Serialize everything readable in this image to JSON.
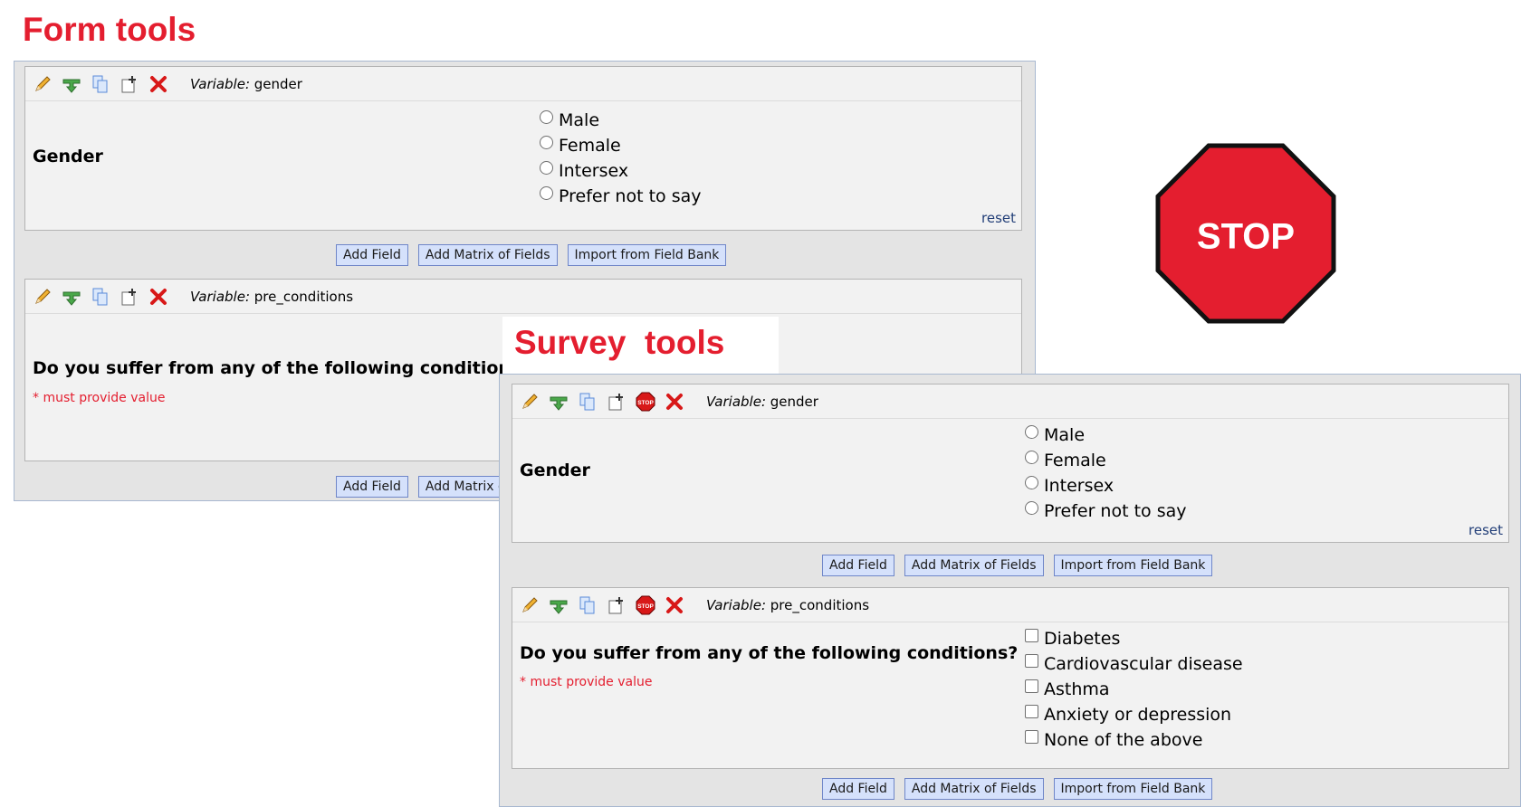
{
  "form_section": {
    "heading": "Form tools",
    "fields": [
      {
        "variable_label": "Variable:",
        "variable_name": "gender",
        "question": "Gender",
        "options": [
          "Male",
          "Female",
          "Intersex",
          "Prefer not to say"
        ],
        "reset_label": "reset"
      },
      {
        "variable_label": "Variable:",
        "variable_name": "pre_conditions",
        "question": "Do you suffer from any of the following conditions?",
        "required_note": "* must provide value"
      }
    ],
    "buttons": [
      "Add Field",
      "Add Matrix of Fields",
      "Import from Field Bank"
    ],
    "buttons_bottom_visible": [
      "Add Field",
      "Add Matrix o"
    ]
  },
  "survey_section": {
    "heading": "Survey  tools",
    "fields": [
      {
        "variable_label": "Variable:",
        "variable_name": "gender",
        "question": "Gender",
        "options": [
          "Male",
          "Female",
          "Intersex",
          "Prefer not to say"
        ],
        "reset_label": "reset"
      },
      {
        "variable_label": "Variable:",
        "variable_name": "pre_conditions",
        "question": "Do you suffer from any of the following conditions?",
        "required_note": "* must provide value",
        "options": [
          "Diabetes",
          "Cardiovascular disease",
          "Asthma",
          "Anxiety or depression",
          "None of the above"
        ]
      }
    ],
    "buttons": [
      "Add Field",
      "Add Matrix of Fields",
      "Import from Field Bank"
    ]
  },
  "stop_sign": {
    "text": "STOP",
    "color": "#e41e2f"
  },
  "icons": {
    "form_toolbar": [
      "pencil-icon",
      "branching-arrow-icon",
      "copy-icon",
      "move-icon",
      "delete-icon"
    ],
    "survey_toolbar": [
      "pencil-icon",
      "branching-arrow-icon",
      "copy-icon",
      "move-icon",
      "stop-action-icon",
      "delete-icon"
    ]
  },
  "colors": {
    "accent_red": "#e41e2f",
    "button_bg": "#d5e1fb",
    "panel_bg": "#e4e4e4",
    "field_bg": "#f2f2f2"
  }
}
